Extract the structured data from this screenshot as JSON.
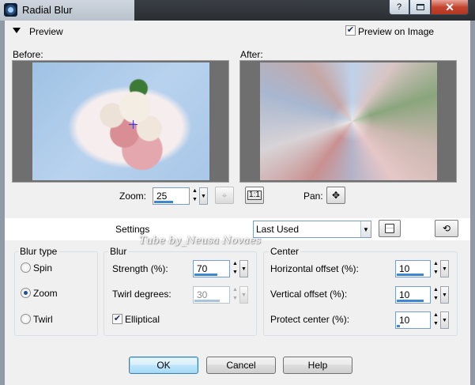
{
  "window": {
    "title": "Radial Blur",
    "help_button": "?",
    "close_button": "✕"
  },
  "preview": {
    "label": "Preview",
    "preview_on_image": {
      "label": "Preview on Image",
      "checked": true
    },
    "before_label": "Before:",
    "after_label": "After:",
    "zoom_label": "Zoom:",
    "zoom_value": "25",
    "actual_size_label": "1:1",
    "pan_label": "Pan:"
  },
  "settings": {
    "label": "Settings",
    "preset": "Last Used"
  },
  "watermark": "Tube by_Neusa Novaes",
  "blur_type": {
    "title": "Blur type",
    "options": [
      {
        "label": "Spin",
        "selected": false
      },
      {
        "label": "Zoom",
        "selected": true
      },
      {
        "label": "Twirl",
        "selected": false
      }
    ]
  },
  "blur": {
    "title": "Blur",
    "strength_label": "Strength (%):",
    "strength_value": "70",
    "strength_fraction": 0.7,
    "twirl_label": "Twirl degrees:",
    "twirl_value": "30",
    "twirl_fraction": 0.75,
    "elliptical": {
      "label": "Elliptical",
      "checked": true
    }
  },
  "center": {
    "title": "Center",
    "horizontal_label": "Horizontal offset (%):",
    "horizontal_value": "10",
    "horizontal_fraction": 0.8,
    "vertical_label": "Vertical offset (%):",
    "vertical_value": "10",
    "vertical_fraction": 0.8,
    "protect_label": "Protect center (%):",
    "protect_value": "10",
    "protect_fraction": 0.1
  },
  "buttons": {
    "ok": "OK",
    "cancel": "Cancel",
    "help": "Help"
  }
}
